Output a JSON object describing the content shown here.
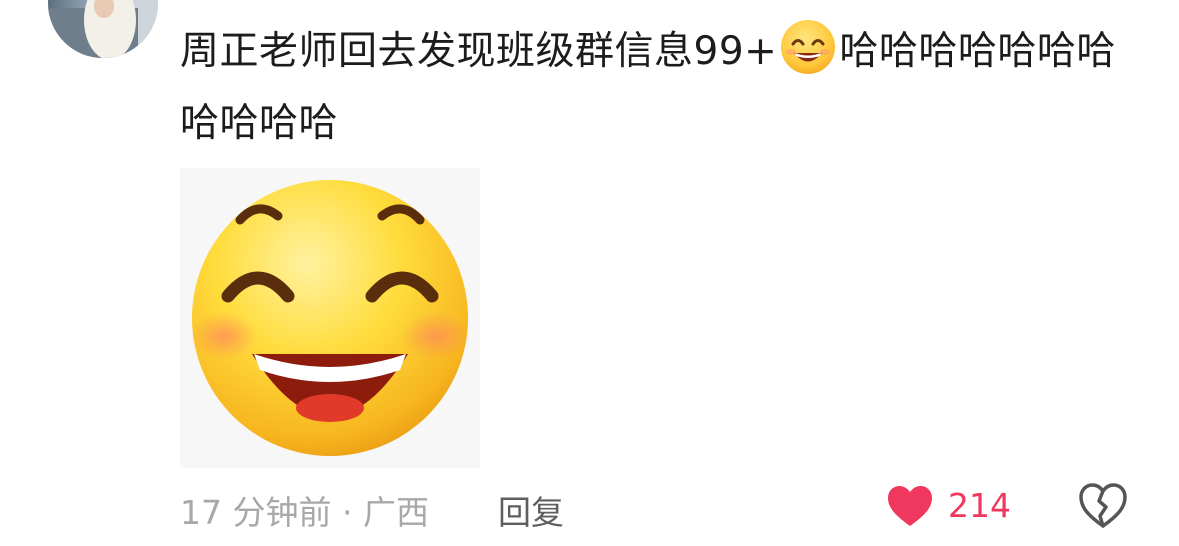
{
  "comment": {
    "text_part1": "周正老师回去发现班级群信息99+",
    "text_part2": "哈哈哈哈哈哈哈哈哈哈哈",
    "inline_emoji": "grinning-face-emoji",
    "sticker": "big-laughing-face-sticker"
  },
  "meta": {
    "time_location": "17 分钟前 · 广西",
    "reply_label": "回复",
    "like_count": "214"
  },
  "colors": {
    "text": "#1c1c1c",
    "meta": "#a8a8a8",
    "reply": "#5f5f5f",
    "like": "#f0385e",
    "icon": "#555555"
  }
}
